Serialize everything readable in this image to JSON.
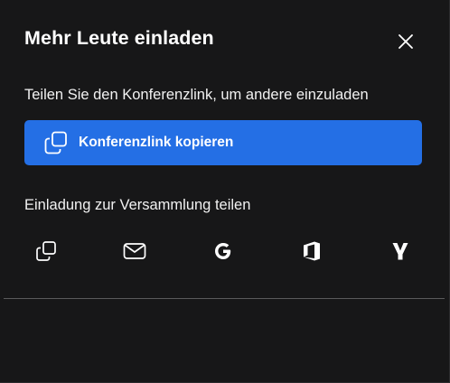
{
  "dialog": {
    "title": "Mehr Leute einladen",
    "close_icon": "close-icon"
  },
  "share_link": {
    "description": "Teilen Sie den Konferenzlink, um andere einzuladen",
    "button_label": "Konferenzlink kopieren",
    "button_icon": "copy-icon",
    "button_color": "#246fe5"
  },
  "invite": {
    "description": "Einladung zur Versammlung teilen",
    "options": [
      {
        "icon": "copy-icon"
      },
      {
        "icon": "email-icon"
      },
      {
        "icon": "google-icon"
      },
      {
        "icon": "office-icon"
      },
      {
        "icon": "yahoo-icon"
      }
    ]
  },
  "colors": {
    "background": "#171718",
    "text": "#ffffff",
    "accent": "#246fe5",
    "divider": "#5a5a5c"
  }
}
